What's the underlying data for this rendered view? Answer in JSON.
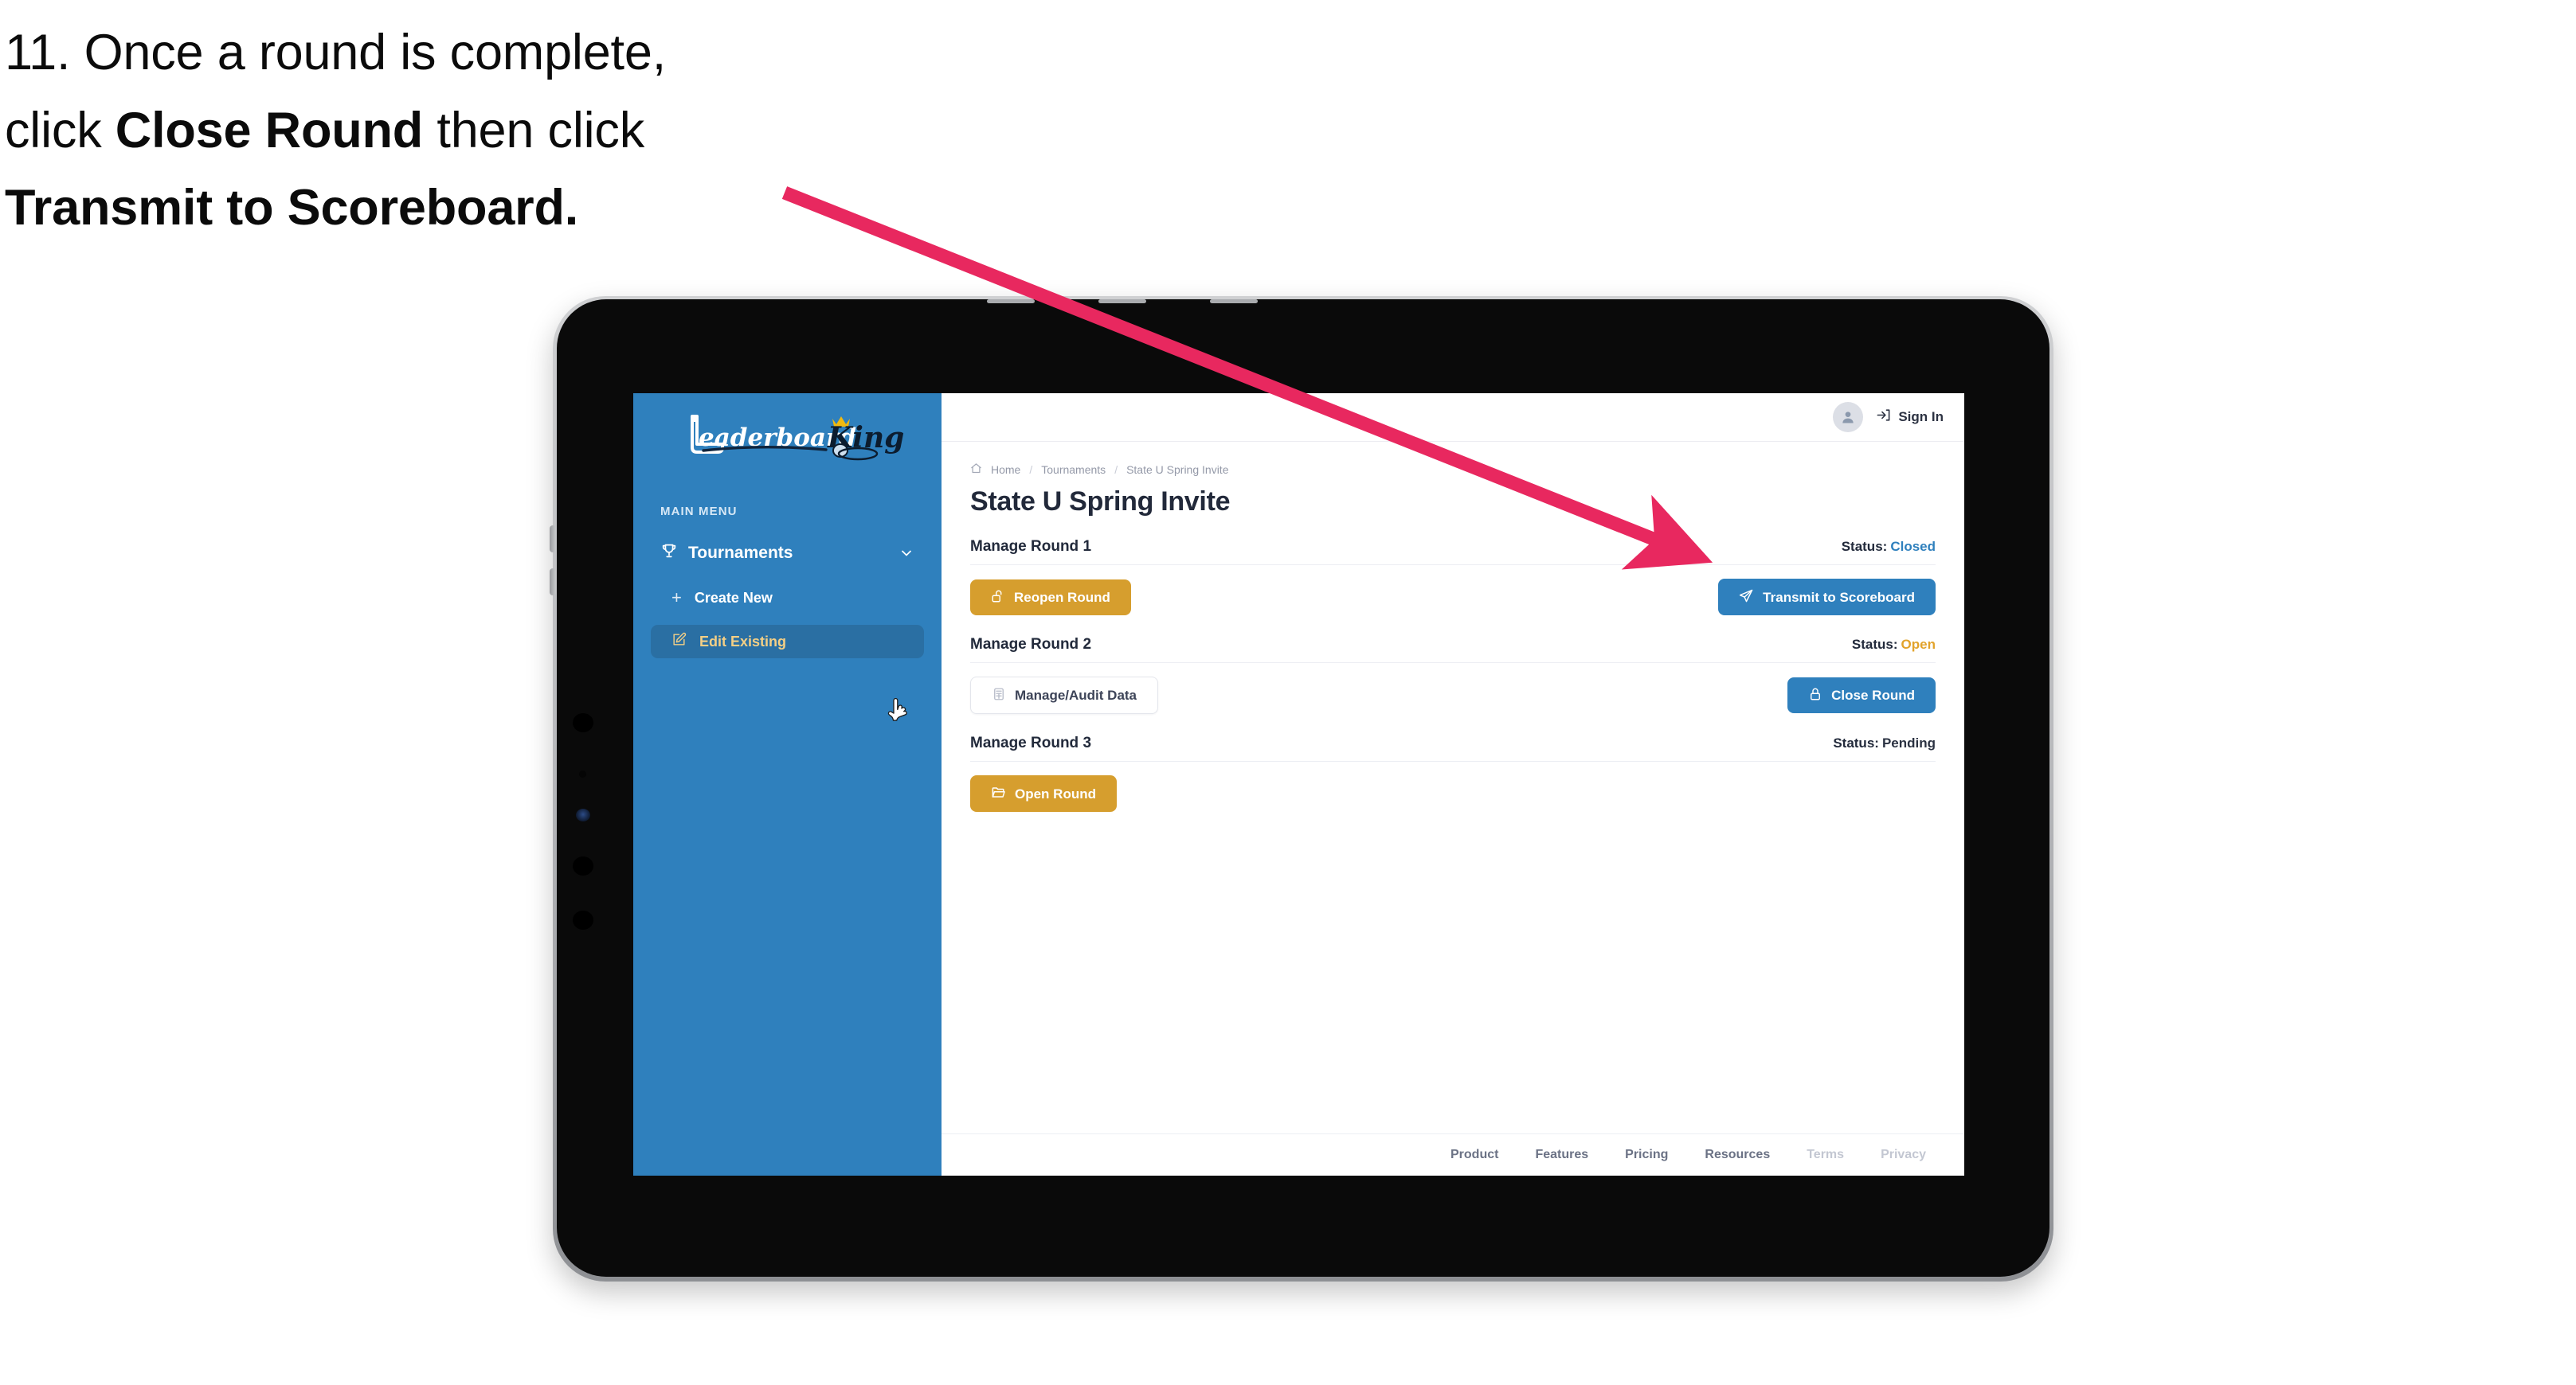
{
  "annotation": {
    "step_number": "11.",
    "line1_pre": "11. Once a round is complete,",
    "line2_pre": "click ",
    "line2_bold": "Close Round",
    "line2_post": " then click",
    "line3_bold": "Transmit to Scoreboard.",
    "arrow_color": "#e8285f"
  },
  "colors": {
    "sidebar_blue": "#2f80bd",
    "sidebar_active": "#2a6fa3",
    "active_text_gold": "#f3cf86",
    "button_gold": "#d69e2e",
    "button_blue": "#2f80bd",
    "status_open": "#e2a32b",
    "status_closed": "#2f80bd",
    "text_dark": "#22293a"
  },
  "sidebar": {
    "logo_primary": "Leaderboard",
    "logo_secondary": "King",
    "menu_label": "MAIN MENU",
    "nav": {
      "label": "Tournaments",
      "icon": "trophy-icon",
      "chevron": "chevron-down-icon"
    },
    "sub_items": [
      {
        "label": "Create New",
        "icon": "plus-icon",
        "active": false
      },
      {
        "label": "Edit Existing",
        "icon": "pencil-square-icon",
        "active": true
      }
    ]
  },
  "topbar": {
    "avatar_icon": "user-avatar-icon",
    "signin_icon": "sign-in-icon",
    "signin_label": "Sign In"
  },
  "breadcrumb": {
    "home_icon": "home-icon",
    "items": [
      "Home",
      "Tournaments",
      "State U Spring Invite"
    ],
    "separator": "/"
  },
  "page": {
    "title": "State U Spring Invite"
  },
  "rounds": [
    {
      "name": "Manage Round 1",
      "status_label": "Status:",
      "status_value": "Closed",
      "status_class": "st-closed",
      "left_button": {
        "label": "Reopen Round",
        "icon": "unlock-icon",
        "style": "btn-gold"
      },
      "right_button": {
        "label": "Transmit to Scoreboard",
        "icon": "paper-plane-icon",
        "style": "btn-blue"
      }
    },
    {
      "name": "Manage Round 2",
      "status_label": "Status:",
      "status_value": "Open",
      "status_class": "st-open",
      "left_button": {
        "label": "Manage/Audit Data",
        "icon": "spreadsheet-icon",
        "style": "btn-ghost"
      },
      "right_button": {
        "label": "Close Round",
        "icon": "lock-icon",
        "style": "btn-blue"
      }
    },
    {
      "name": "Manage Round 3",
      "status_label": "Status:",
      "status_value": "Pending",
      "status_class": "st-pending",
      "left_button": {
        "label": "Open Round",
        "icon": "folder-open-icon",
        "style": "btn-gold"
      },
      "right_button": null
    }
  ],
  "footer": {
    "links": [
      {
        "label": "Product",
        "muted": false
      },
      {
        "label": "Features",
        "muted": false
      },
      {
        "label": "Pricing",
        "muted": false
      },
      {
        "label": "Resources",
        "muted": false
      },
      {
        "label": "Terms",
        "muted": true
      },
      {
        "label": "Privacy",
        "muted": true
      }
    ]
  }
}
